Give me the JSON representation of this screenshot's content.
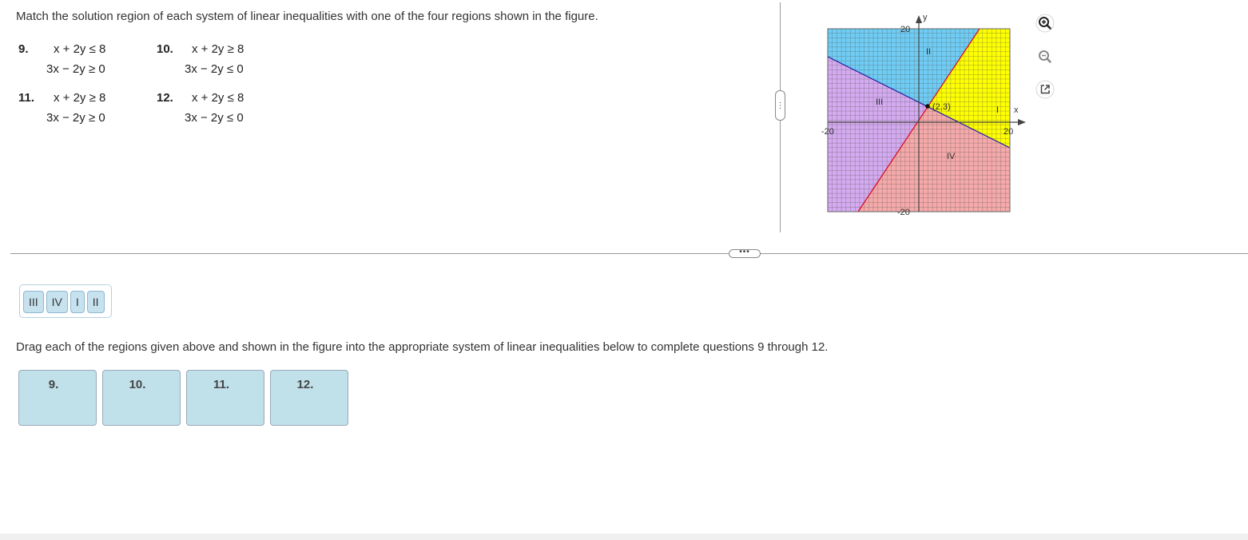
{
  "instructions": "Match the solution region of each system of linear inequalities with one of the four regions shown in the figure.",
  "problems": [
    {
      "num": "9.",
      "line1": "x + 2y ≤ 8",
      "line2": "3x − 2y ≥ 0"
    },
    {
      "num": "10.",
      "line1": "x + 2y ≥ 8",
      "line2": "3x − 2y ≤ 0"
    },
    {
      "num": "11.",
      "line1": "x + 2y ≥ 8",
      "line2": "3x − 2y ≥ 0"
    },
    {
      "num": "12.",
      "line1": "x + 2y ≤ 8",
      "line2": "3x − 2y ≤ 0"
    }
  ],
  "graph": {
    "x_label": "x",
    "y_label": "y",
    "tick_labels": {
      "x_min": "-20",
      "x_max": "20",
      "y_max": "20",
      "y_min": "-20"
    },
    "point_label": "(2,3)",
    "region_labels": {
      "I": "I",
      "II": "II",
      "III": "III",
      "IV": "IV"
    },
    "colors": {
      "region_I": "#ffff00",
      "region_II": "#6fcdf5",
      "region_III": "#d4aaf0",
      "region_IV": "#f5a9a9",
      "line_red": "#e0001a",
      "line_blue": "#1a1aa0",
      "grid": "#555555"
    }
  },
  "tools": {
    "zoom_in": "zoom-in-icon",
    "zoom_out": "zoom-out-icon",
    "popout": "external-link-icon"
  },
  "tray": {
    "tiles": [
      "III",
      "IV",
      "I",
      "II"
    ]
  },
  "drag_instructions": "Drag each of the regions given above and shown in the figure into the appropriate system of linear inequalities below to complete questions 9 through 12.",
  "drop_targets": [
    "9.",
    "10.",
    "11.",
    "12."
  ],
  "vertical_handle": "⋮",
  "horizontal_handle": "•••"
}
